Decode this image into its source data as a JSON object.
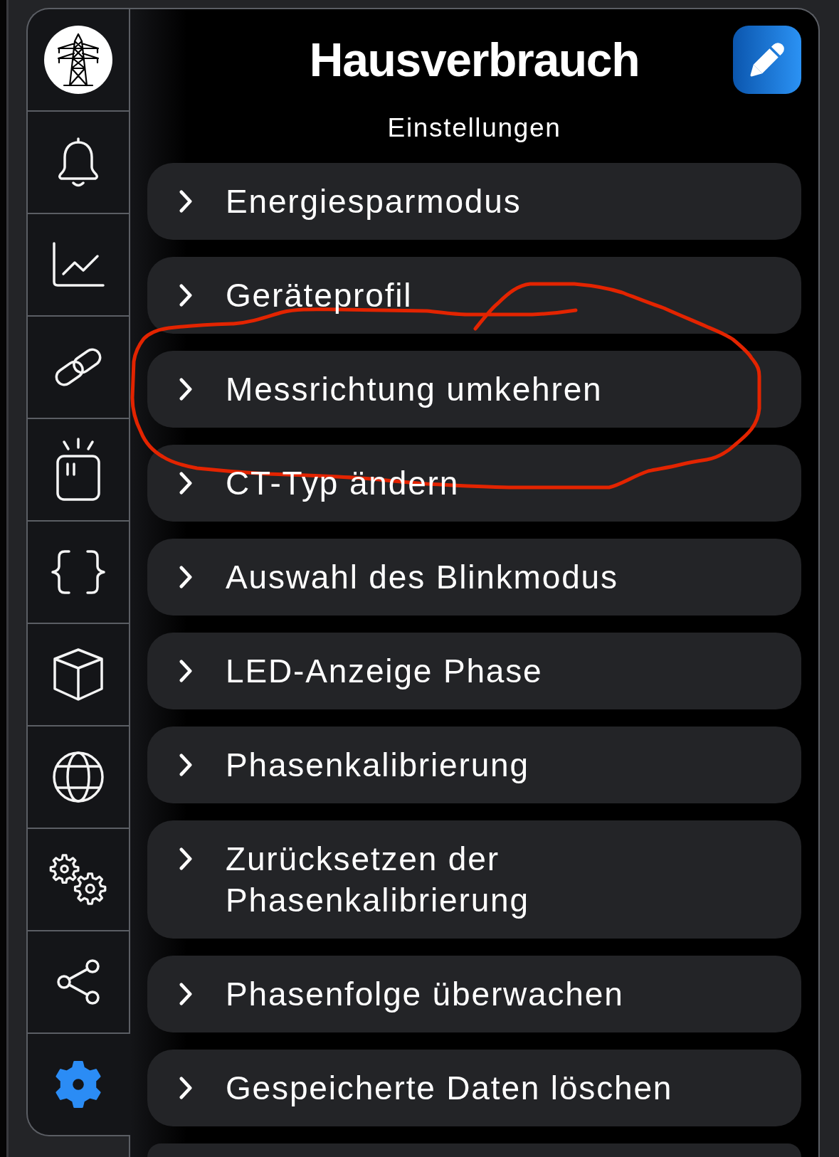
{
  "sidebar": {
    "items": [
      {
        "selected": false
      },
      {
        "selected": false
      },
      {
        "selected": false
      },
      {
        "selected": false
      },
      {
        "selected": false
      },
      {
        "selected": false
      },
      {
        "selected": false
      },
      {
        "selected": false
      },
      {
        "selected": false
      },
      {
        "selected": true
      }
    ]
  },
  "header": {
    "title": "Hausverbrauch",
    "subtitle": "Einstellungen"
  },
  "settings": {
    "items": [
      {
        "kind": "entry",
        "label": "Energiesparmodus",
        "circled": false
      },
      {
        "kind": "entry",
        "label": "Geräteprofil",
        "circled": false
      },
      {
        "kind": "entry",
        "label": "Messrichtung umkehren",
        "circled": true
      },
      {
        "kind": "entry",
        "label": "CT-Typ ändern",
        "circled": false
      },
      {
        "kind": "entry",
        "label": "Auswahl des Blinkmodus",
        "circled": false
      },
      {
        "kind": "entry",
        "label": "LED-Anzeige Phase",
        "circled": false
      },
      {
        "kind": "entry",
        "label": "Phasenkalibrierung",
        "circled": false
      },
      {
        "kind": "entry",
        "label": "Zurücksetzen der Phasenkalibrierung",
        "circled": false
      },
      {
        "kind": "entry",
        "label": "Phasenfolge überwachen",
        "circled": false
      },
      {
        "kind": "entry",
        "label": "Gespeicherte Daten löschen",
        "circled": false
      },
      {
        "kind": "partial",
        "circled": false
      }
    ]
  }
}
